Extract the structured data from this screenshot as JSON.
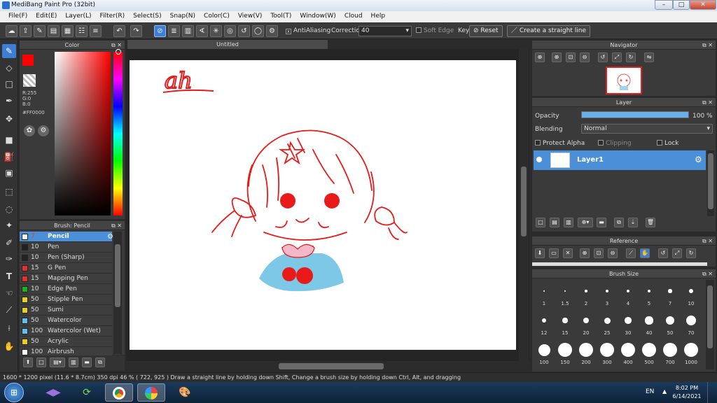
{
  "window": {
    "title": "MediBang Paint Pro (32bit)",
    "min": "–",
    "max": "□",
    "close": "✕"
  },
  "menu": [
    "File(F)",
    "Edit(E)",
    "Layer(L)",
    "Filter(R)",
    "Select(S)",
    "Snap(N)",
    "Color(C)",
    "View(V)",
    "Tool(T)",
    "Window(W)",
    "Cloud",
    "Help"
  ],
  "toolbar": {
    "antialiasing": "AntiAliasing",
    "correction_label": "Correction",
    "correction_value": "40",
    "soft_edge": "Soft Edge",
    "key_label": "Key",
    "reset": "Reset",
    "straight_line": "Create a straight line"
  },
  "color_panel": {
    "title": "Color",
    "r": "R:255",
    "g": "G:0",
    "b": "B:0",
    "hex": "#FF0000",
    "main_color": "#ff0000"
  },
  "brush_panel": {
    "title": "Brush: Pencil",
    "brushes": [
      {
        "size": "7",
        "name": "Pencil",
        "color": "#ffffff"
      },
      {
        "size": "10",
        "name": "Pen",
        "color": "#222222"
      },
      {
        "size": "10",
        "name": "Pen (Sharp)",
        "color": "#222222"
      },
      {
        "size": "15",
        "name": "G Pen",
        "color": "#e03030"
      },
      {
        "size": "15",
        "name": "Mapping Pen",
        "color": "#e03030"
      },
      {
        "size": "10",
        "name": "Edge Pen",
        "color": "#20b020"
      },
      {
        "size": "50",
        "name": "Stipple Pen",
        "color": "#e8d020"
      },
      {
        "size": "50",
        "name": "Sumi",
        "color": "#e8d020"
      },
      {
        "size": "50",
        "name": "Watercolor",
        "color": "#60c0f0"
      },
      {
        "size": "100",
        "name": "Watercolor (Wet)",
        "color": "#60c0f0"
      },
      {
        "size": "50",
        "name": "Acrylic",
        "color": "#e8d020"
      },
      {
        "size": "100",
        "name": "Airbrush",
        "color": "#ffffff"
      }
    ]
  },
  "canvas": {
    "tab_title": "Untitled",
    "handwriting": "ah"
  },
  "navigator": {
    "title": "Navigator"
  },
  "layer_panel": {
    "title": "Layer",
    "opacity_label": "Opacity",
    "opacity_value": "100 %",
    "opacity_fraction": 1.0,
    "blending_label": "Blending",
    "blending_value": "Normal",
    "protect_alpha": "Protect Alpha",
    "clipping": "Clipping",
    "lock": "Lock",
    "layers": [
      {
        "name": "Layer1"
      }
    ]
  },
  "reference": {
    "title": "Reference"
  },
  "brush_size": {
    "title": "Brush Size",
    "sizes": [
      "1",
      "1.5",
      "2",
      "3",
      "4",
      "5",
      "7",
      "10",
      "12",
      "15",
      "20",
      "25",
      "30",
      "40",
      "50",
      "70",
      "100",
      "150",
      "200",
      "300",
      "400",
      "500",
      "700",
      "1000"
    ]
  },
  "status": {
    "text": "1600 * 1200 pixel  (11.6 * 8.7cm)  350 dpi  46 %  ( 722, 925 )  Draw a straight line by holding down Shift, Change a brush size by holding down Ctrl, Alt, and dragging"
  },
  "taskbar": {
    "lang": "EN",
    "time": "8:02 PM",
    "date": "6/14/2021"
  }
}
